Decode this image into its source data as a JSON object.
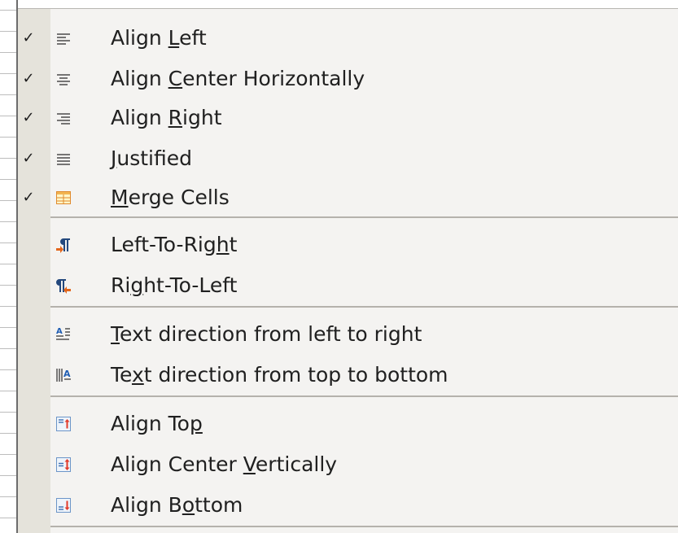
{
  "menu": {
    "items": [
      {
        "name": "align-left",
        "pre": "Align ",
        "mn": "L",
        "post": "eft",
        "checked": true,
        "icon": "align-left-icon"
      },
      {
        "name": "align-center-horizontally",
        "pre": "Align ",
        "mn": "C",
        "post": "enter Horizontally",
        "checked": true,
        "icon": "align-center-icon"
      },
      {
        "name": "align-right",
        "pre": "Align ",
        "mn": "R",
        "post": "ight",
        "checked": true,
        "icon": "align-right-icon"
      },
      {
        "name": "justified",
        "pre": "",
        "mn": "J",
        "post": "ustified",
        "checked": true,
        "icon": "justify-icon"
      },
      {
        "name": "merge-cells",
        "pre": "",
        "mn": "M",
        "post": "erge Cells",
        "checked": true,
        "icon": "merge-cells-icon"
      },
      {
        "name": "left-to-right",
        "pre": "Left-To-Rig",
        "mn": "h",
        "post": "t",
        "checked": false,
        "icon": "paragraph-ltr-icon"
      },
      {
        "name": "right-to-left",
        "pre": "Ri",
        "mn": "g",
        "post": "ht-To-Left",
        "checked": false,
        "icon": "paragraph-rtl-icon"
      },
      {
        "name": "text-direction-left-to-right",
        "pre": "",
        "mn": "T",
        "post": "ext direction from left to right",
        "checked": false,
        "icon": "text-direction-horizontal-icon"
      },
      {
        "name": "text-direction-top-to-bottom",
        "pre": "Te",
        "mn": "x",
        "post": "t direction from top to bottom",
        "checked": false,
        "icon": "text-direction-vertical-icon"
      },
      {
        "name": "align-top",
        "pre": "Align To",
        "mn": "p",
        "post": "",
        "checked": false,
        "icon": "align-top-icon"
      },
      {
        "name": "align-center-vertically",
        "pre": "Align Center ",
        "mn": "V",
        "post": "ertically",
        "checked": false,
        "icon": "align-middle-icon"
      },
      {
        "name": "align-bottom",
        "pre": "Align B",
        "mn": "o",
        "post": "ttom",
        "checked": false,
        "icon": "align-bottom-icon"
      }
    ],
    "check_glyph": "✓"
  }
}
